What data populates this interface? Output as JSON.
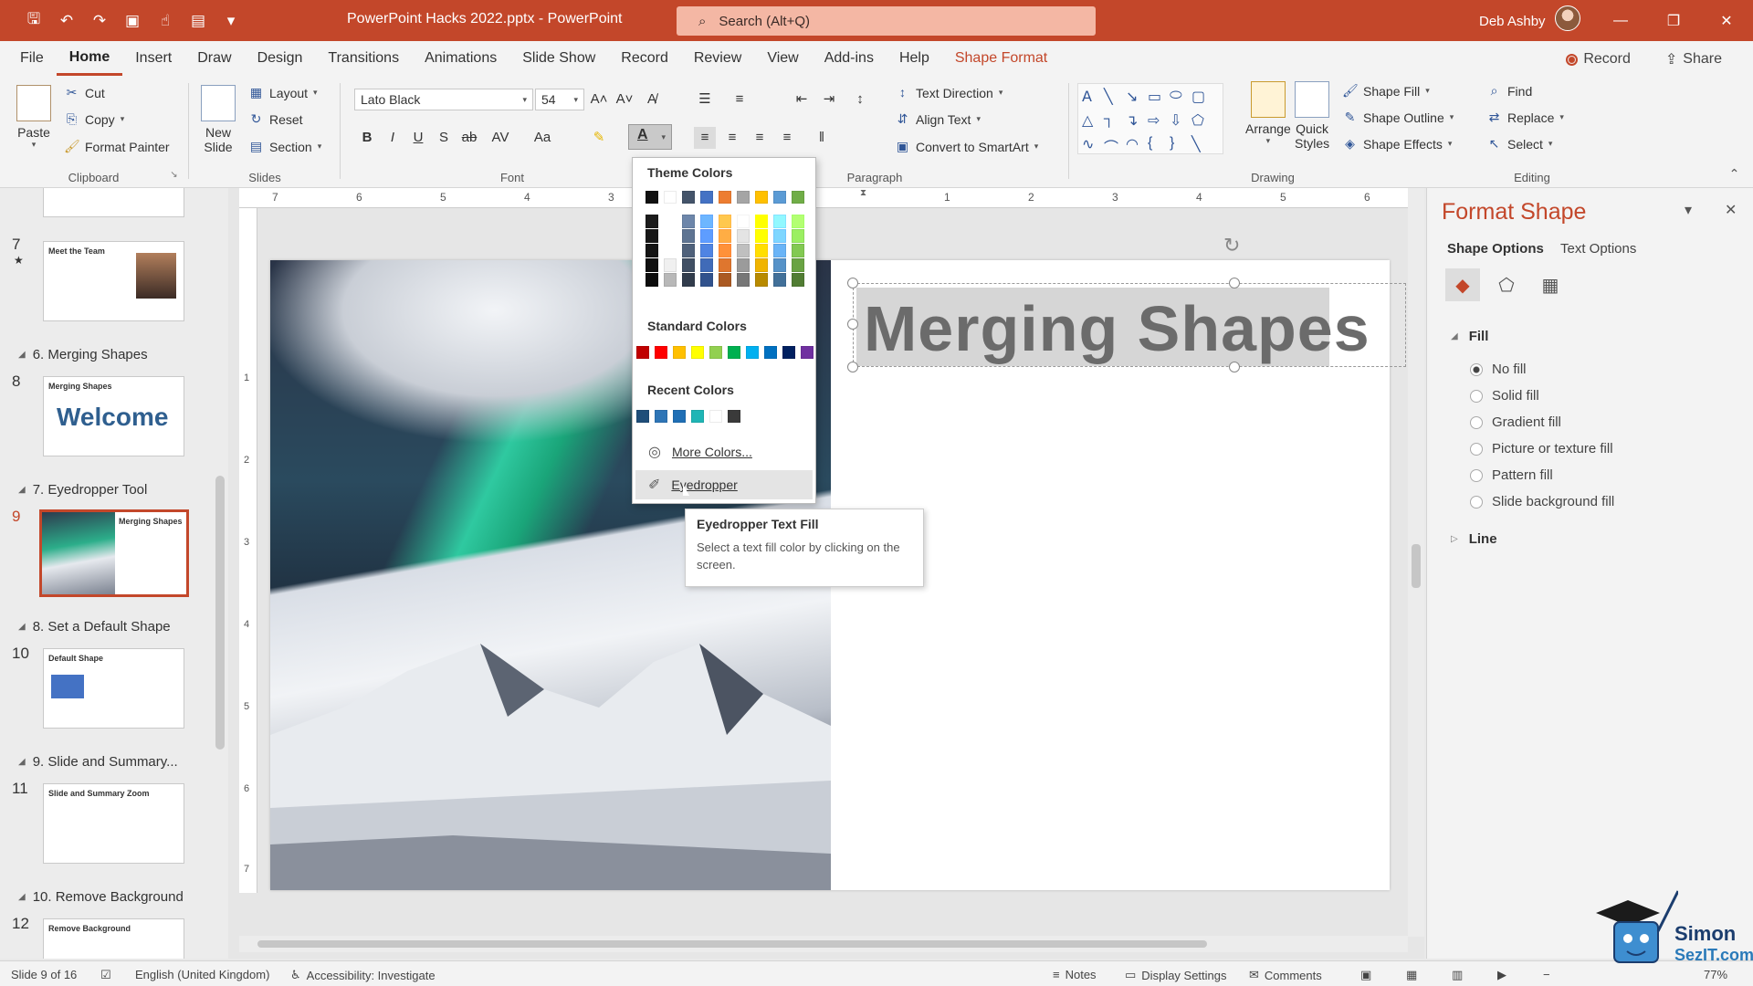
{
  "window": {
    "doc_title": "PowerPoint Hacks 2022.pptx - PowerPoint",
    "search_placeholder": "Search (Alt+Q)",
    "user_name": "Deb Ashby"
  },
  "menu": {
    "tabs": [
      "File",
      "Home",
      "Insert",
      "Draw",
      "Design",
      "Transitions",
      "Animations",
      "Slide Show",
      "Record",
      "Review",
      "View",
      "Add-ins",
      "Help",
      "Shape Format"
    ],
    "active": "Home",
    "record_label": "Record",
    "share_label": "Share"
  },
  "ribbon": {
    "clipboard": {
      "paste": "Paste",
      "cut": "Cut",
      "copy": "Copy",
      "format_painter": "Format Painter",
      "label": "Clipboard"
    },
    "slides": {
      "new_slide_1": "New",
      "new_slide_2": "Slide",
      "layout": "Layout",
      "reset": "Reset",
      "section": "Section",
      "label": "Slides"
    },
    "font": {
      "family": "Lato Black",
      "size": "54",
      "label": "Font"
    },
    "paragraph": {
      "text_direction": "Text Direction",
      "align_text": "Align Text",
      "convert_smartart": "Convert to SmartArt",
      "label": "Paragraph"
    },
    "drawing": {
      "arrange": "Arrange",
      "quick_styles_1": "Quick",
      "quick_styles_2": "Styles",
      "shape_fill": "Shape Fill",
      "shape_outline": "Shape Outline",
      "shape_effects": "Shape Effects",
      "label": "Drawing"
    },
    "editing": {
      "find": "Find",
      "replace": "Replace",
      "select": "Select",
      "label": "Editing"
    }
  },
  "thumbnails": {
    "slides": [
      {
        "num": "7",
        "title": "Meet the Team"
      },
      {
        "num": "8",
        "title": "Merging Shapes",
        "big": "Welcome"
      },
      {
        "num": "9",
        "title": "Merging Shapes"
      },
      {
        "num": "10",
        "title": "Default Shape"
      },
      {
        "num": "11",
        "title": "Slide and Summary Zoom"
      },
      {
        "num": "12",
        "title": "Remove Background"
      }
    ],
    "sections": [
      "6. Merging Shapes",
      "7. Eyedropper Tool",
      "8. Set a Default Shape",
      "9. Slide and Summary...",
      "10. Remove Background"
    ]
  },
  "slide": {
    "title": "Merging Shapes"
  },
  "ruler": {
    "h": [
      "7",
      "6",
      "5",
      "4",
      "3",
      "1",
      "2",
      "3",
      "4",
      "5",
      "6"
    ],
    "v": [
      "1",
      "2",
      "3",
      "4",
      "5",
      "6",
      "7"
    ]
  },
  "color_menu": {
    "theme_colors": "Theme Colors",
    "standard_colors": "Standard Colors",
    "recent_colors": "Recent Colors",
    "more_colors": "More Colors...",
    "eyedropper": "Eyedropper",
    "theme_top": [
      "#111111",
      "#ffffff",
      "#44546a",
      "#4472c4",
      "#ed7d31",
      "#a5a5a5",
      "#ffc000",
      "#5b9bd5",
      "#70ad47"
    ],
    "standard": [
      "#c00000",
      "#ff0000",
      "#ffc000",
      "#ffff00",
      "#92d050",
      "#00b050",
      "#00b0f0",
      "#0070c0",
      "#002060",
      "#7030a0"
    ],
    "recent": [
      "#1f4e79",
      "#2e75b6",
      "#1f6fb5",
      "#1fb5b5",
      "#ffffff",
      "#3a3a3a"
    ]
  },
  "tooltip": {
    "title": "Eyedropper Text Fill",
    "body": "Select a text fill color by clicking on the screen."
  },
  "format_pane": {
    "title": "Format Shape",
    "tab_shape": "Shape Options",
    "tab_text": "Text Options",
    "fill_header": "Fill",
    "options": [
      "No fill",
      "Solid fill",
      "Gradient fill",
      "Picture or texture fill",
      "Pattern fill",
      "Slide background fill"
    ],
    "selected_option": "No fill",
    "line_header": "Line"
  },
  "status": {
    "slide_of": "Slide 9 of 16",
    "language": "English (United Kingdom)",
    "accessibility": "Accessibility: Investigate",
    "notes": "Notes",
    "display_settings": "Display Settings",
    "comments": "Comments",
    "zoom": "77%"
  },
  "branding": {
    "line1": "Simon",
    "line2": "SezIT.com"
  },
  "colors": {
    "accent": "#c3472a",
    "search_bg": "#f4b7a4"
  }
}
